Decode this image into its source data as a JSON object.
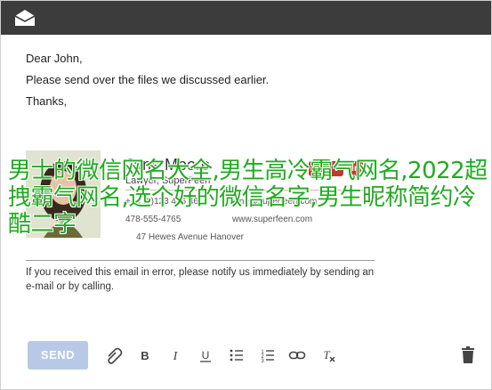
{
  "email": {
    "greeting": "Dear John,",
    "line1": "Please send over the files we discussed earlier.",
    "closing": "Thanks,"
  },
  "signature": {
    "name": "Jane Moore",
    "title": "Lawyer, SuperFeen",
    "phone1": "+44 (0)123 456 46",
    "email": "jane@superfeen.com",
    "phone2": "478-555-4765",
    "website": "www.superfeen.com",
    "address": "47 Hewes Avenue Hanover",
    "social": [
      "f",
      "t",
      "in"
    ],
    "accent": "#c0392b"
  },
  "disclaimer": "If you received this email in error, please notify us immediately by sending an e-mail or by calling.",
  "overlay_text": "男士的微信网名大全,男生高冷霸气网名,2022超拽霸气网名,选个好的微信名字,男生昵称简约冷酷二字",
  "toolbar": {
    "send_label": "SEND",
    "tools": [
      "attach-icon",
      "bold-icon",
      "italic-icon",
      "underline-icon",
      "bulleted-list-icon",
      "numbered-list-icon",
      "link-icon",
      "clear-format-icon"
    ],
    "send_color": "#b7c9e6"
  },
  "colors": {
    "titlebar": "#3c3c3c",
    "overlay": "#22aa22"
  }
}
